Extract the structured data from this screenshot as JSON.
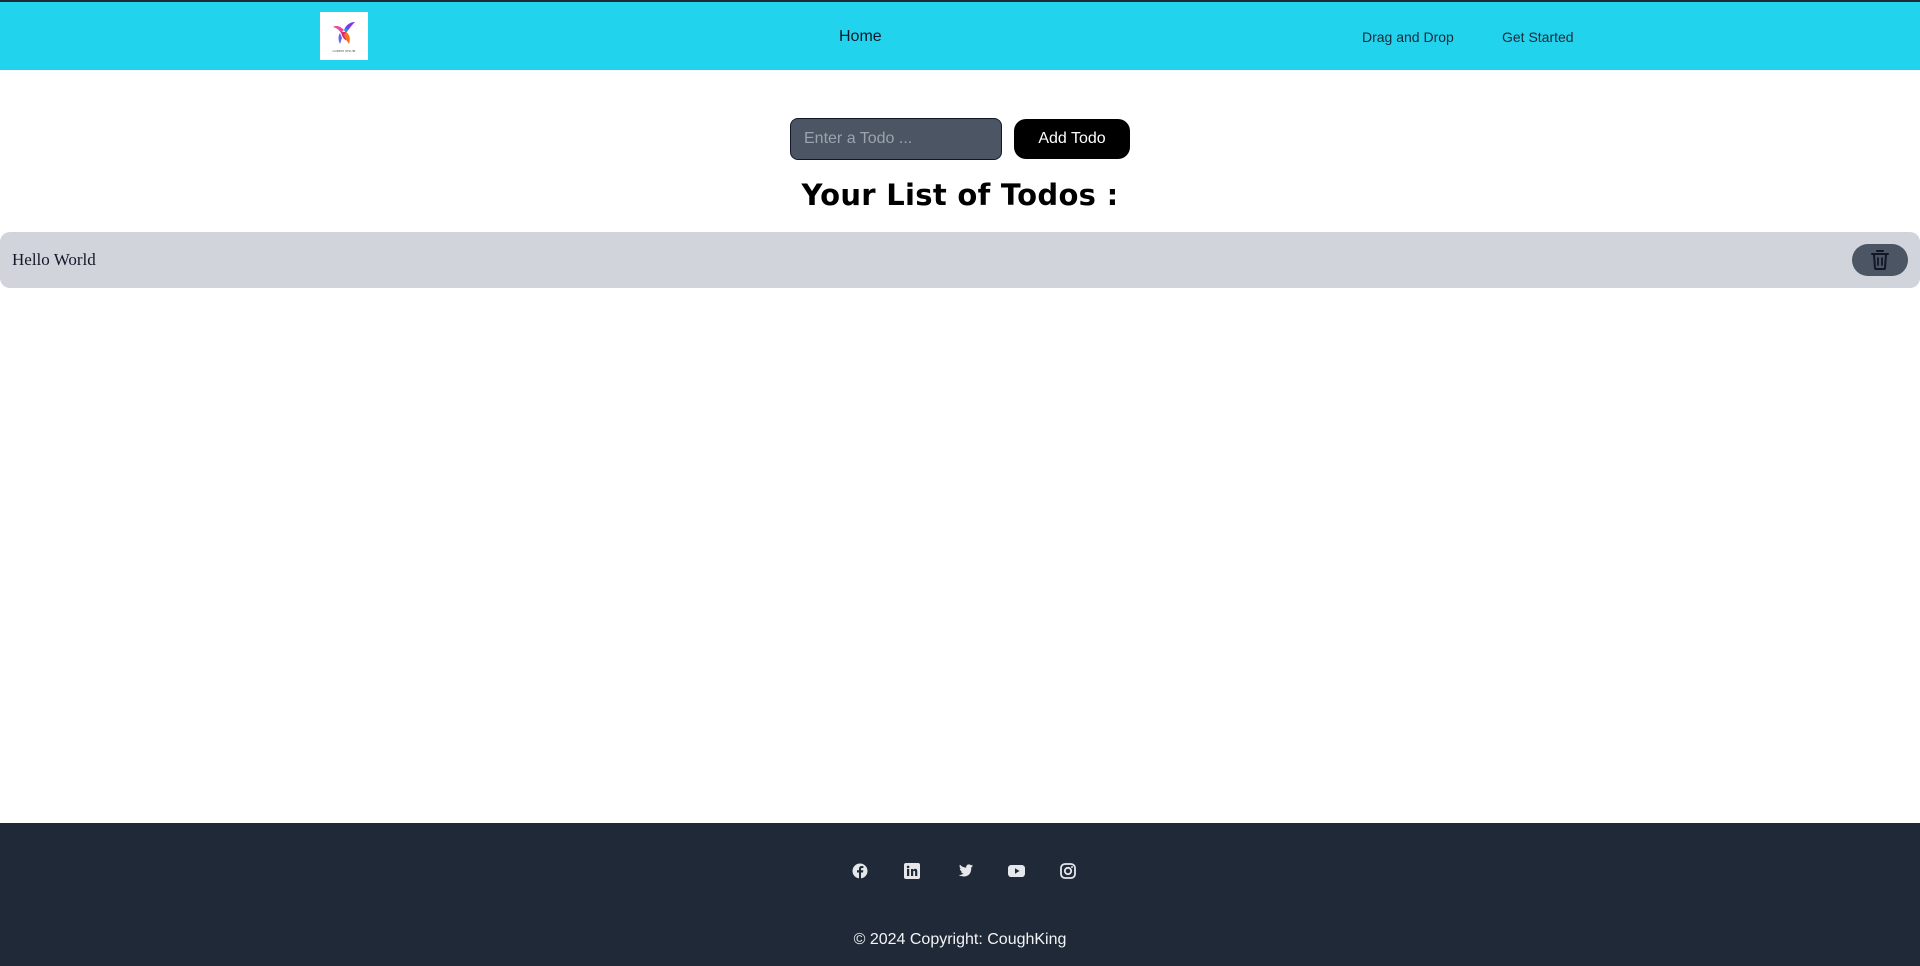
{
  "nav": {
    "logo_text": "LOREM IPSUM",
    "home_label": "Home",
    "drag_drop_label": "Drag and Drop",
    "get_started_label": "Get Started"
  },
  "form": {
    "input_placeholder": "Enter a Todo ...",
    "input_value": "",
    "add_label": "Add Todo"
  },
  "list": {
    "heading": "Your List of Todos :",
    "items": [
      {
        "text": "Hello World"
      }
    ]
  },
  "footer": {
    "socials": [
      "facebook-icon",
      "linkedin-icon",
      "twitter-icon",
      "youtube-icon",
      "instagram-icon"
    ],
    "copyright": "© 2024 Copyright:  CoughKing"
  },
  "colors": {
    "navbar": "#22d3ee",
    "footer": "#1f2937",
    "input_bg": "#4b5563",
    "todo_row": "#d1d5db",
    "add_button": "#000000"
  }
}
